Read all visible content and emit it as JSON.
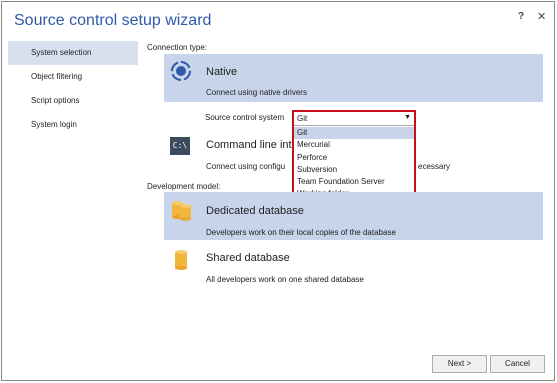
{
  "window": {
    "title": "Source control setup wizard",
    "help": "?",
    "close": "✕"
  },
  "sidebar": {
    "items": [
      {
        "label": "System selection"
      },
      {
        "label": "Object filtering"
      },
      {
        "label": "Script options"
      },
      {
        "label": "System login"
      }
    ]
  },
  "connection": {
    "label": "Connection type:",
    "native": {
      "title": "Native",
      "desc": "Connect using native drivers"
    },
    "source_control_label": "Source control system",
    "dropdown": {
      "value": "Git",
      "options": [
        "Git",
        "Mercurial",
        "Perforce",
        "Subversion",
        "Team Foundation Server",
        "Working folder"
      ]
    },
    "cli": {
      "title": "Command line int",
      "desc": "Connect using configu",
      "desc_tail": "ecessary",
      "icon_text": "C:\\"
    }
  },
  "development": {
    "label": "Development model:",
    "dedicated": {
      "title": "Dedicated database",
      "desc": "Developers work on their local copies of the database"
    },
    "shared": {
      "title": "Shared database",
      "desc": "All developers work on one shared database"
    }
  },
  "footer": {
    "next": "Next >",
    "cancel": "Cancel"
  },
  "colors": {
    "title": "#2e5aa8",
    "selected": "#c7d4ea",
    "highlight_border": "#c8101c",
    "db_icon": "#f2b63d"
  }
}
